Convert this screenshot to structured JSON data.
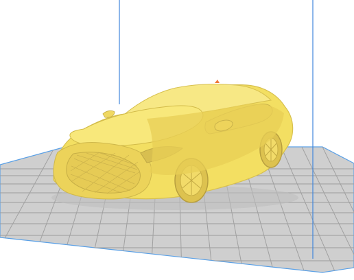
{
  "scene": {
    "background_color": "#ffffff",
    "build_plate": {
      "fill_color": "#c9c9c9",
      "grid_color": "#9a9a9a",
      "edge_color": "#5aa0e6",
      "grid_visible": true
    },
    "build_volume": {
      "line_color": "#3f86dc"
    },
    "model": {
      "name_hint": "car",
      "color": "#f3df62",
      "shade_color": "#d8c24a",
      "highlight_color": "#fff0a0"
    }
  }
}
